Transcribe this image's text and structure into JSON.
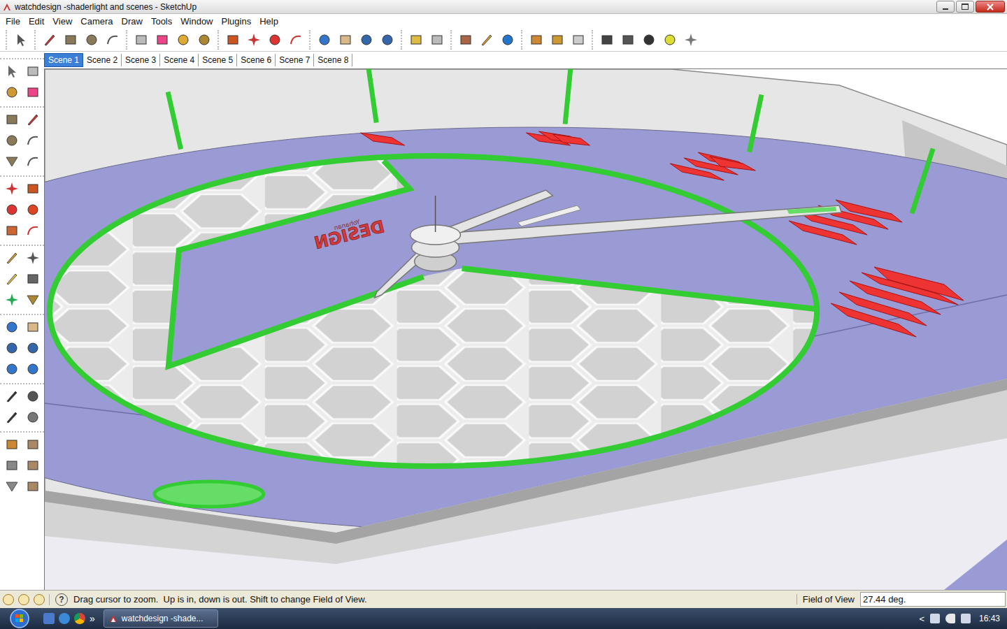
{
  "window": {
    "title": "watchdesign -shaderlight and scenes - SketchUp"
  },
  "menu": [
    "File",
    "Edit",
    "View",
    "Camera",
    "Draw",
    "Tools",
    "Window",
    "Plugins",
    "Help"
  ],
  "scenes": [
    {
      "label": "Scene 1",
      "selected": true
    },
    {
      "label": "Scene 2",
      "selected": false
    },
    {
      "label": "Scene 3",
      "selected": false
    },
    {
      "label": "Scene 4",
      "selected": false
    },
    {
      "label": "Scene 5",
      "selected": false
    },
    {
      "label": "Scene 6",
      "selected": false
    },
    {
      "label": "Scene 7",
      "selected": false
    },
    {
      "label": "Scene 8",
      "selected": false
    }
  ],
  "model": {
    "logo": {
      "title": "DESIGN",
      "subtitle": "Yohanan"
    }
  },
  "status_bar": {
    "help_icon": "?",
    "hint": "Drag cursor to zoom.  Up is in, down is out. Shift to change Field of View.",
    "measure_label": "Field of View",
    "measure_value": "27.44 deg."
  },
  "taskbar": {
    "expand": "»",
    "task": "watchdesign -shade...",
    "tray_arrow": "<",
    "clock": "16:43"
  }
}
